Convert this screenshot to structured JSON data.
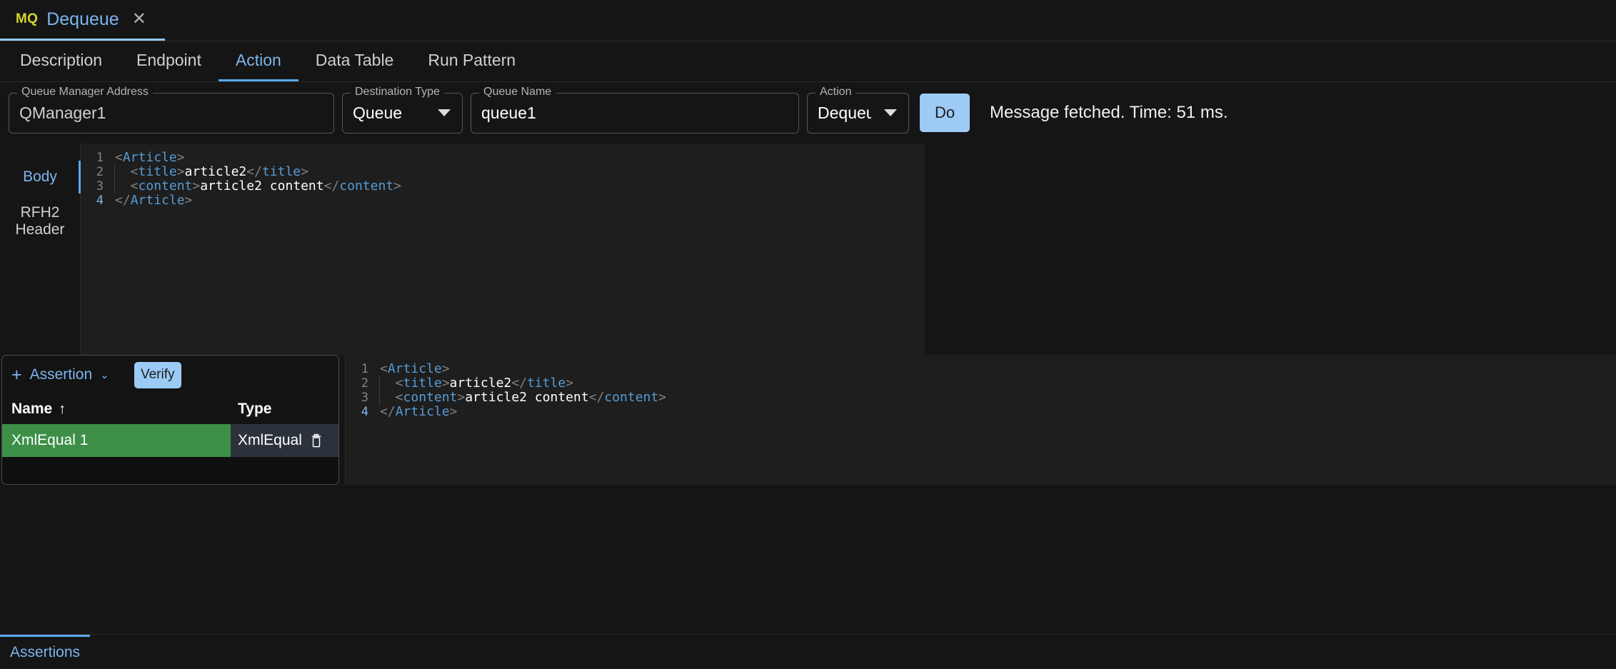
{
  "window_tab": {
    "badge": "MQ",
    "title": "Dequeue",
    "close_icon": "✕"
  },
  "nav_tabs": [
    {
      "label": "Description",
      "active": false
    },
    {
      "label": "Endpoint",
      "active": false
    },
    {
      "label": "Action",
      "active": true
    },
    {
      "label": "Data Table",
      "active": false
    },
    {
      "label": "Run Pattern",
      "active": false
    }
  ],
  "action_bar": {
    "queue_manager": {
      "label": "Queue Manager Address",
      "value": "QManager1"
    },
    "destination_type": {
      "label": "Destination Type",
      "value": "Queue"
    },
    "queue_name": {
      "label": "Queue Name",
      "value": "queue1"
    },
    "action": {
      "label": "Action",
      "value": "Dequeue"
    },
    "do_button": "Do",
    "status": "Message fetched. Time: 51 ms."
  },
  "message_tabs": [
    {
      "label": "Body",
      "active": true
    },
    {
      "label": "RFH2 Header",
      "active": false
    }
  ],
  "body_editor": {
    "lines": [
      {
        "no": "1",
        "segments": [
          {
            "t": "<",
            "c": "tagpunct"
          },
          {
            "t": "Article",
            "c": "tagname"
          },
          {
            "t": ">",
            "c": "tagpunct"
          }
        ]
      },
      {
        "no": "2",
        "segments": [
          {
            "t": "  <",
            "c": "tagpunct"
          },
          {
            "t": "title",
            "c": "tagname"
          },
          {
            "t": ">",
            "c": "tagpunct"
          },
          {
            "t": "article2",
            "c": "text"
          },
          {
            "t": "</",
            "c": "tagpunct"
          },
          {
            "t": "title",
            "c": "tagname"
          },
          {
            "t": ">",
            "c": "tagpunct"
          }
        ]
      },
      {
        "no": "3",
        "segments": [
          {
            "t": "  <",
            "c": "tagpunct"
          },
          {
            "t": "content",
            "c": "tagname"
          },
          {
            "t": ">",
            "c": "tagpunct"
          },
          {
            "t": "article2 content",
            "c": "text"
          },
          {
            "t": "</",
            "c": "tagpunct"
          },
          {
            "t": "content",
            "c": "tagname"
          },
          {
            "t": ">",
            "c": "tagpunct"
          }
        ]
      },
      {
        "no": "4",
        "segments": [
          {
            "t": "</",
            "c": "tagpunct"
          },
          {
            "t": "Article",
            "c": "tagname"
          },
          {
            "t": ">",
            "c": "tagpunct"
          }
        ],
        "active": true
      }
    ]
  },
  "assertions_panel": {
    "add_label": "Assertion",
    "add_icon": "+",
    "chevron_icon": "⌄",
    "verify_button": "Verify",
    "columns": [
      {
        "label": "Name",
        "sort": "↑"
      },
      {
        "label": "Type",
        "sort": ""
      }
    ],
    "rows": [
      {
        "name": "XmlEqual 1",
        "type": "XmlEqual",
        "status_color": "#3d8f47",
        "delete_icon": "trash-icon"
      }
    ]
  },
  "assertion_editor": {
    "lines": [
      {
        "no": "1",
        "segments": [
          {
            "t": "<",
            "c": "tagpunct"
          },
          {
            "t": "Article",
            "c": "tagname"
          },
          {
            "t": ">",
            "c": "tagpunct"
          }
        ]
      },
      {
        "no": "2",
        "segments": [
          {
            "t": "  <",
            "c": "tagpunct"
          },
          {
            "t": "title",
            "c": "tagname"
          },
          {
            "t": ">",
            "c": "tagpunct"
          },
          {
            "t": "article2",
            "c": "text"
          },
          {
            "t": "</",
            "c": "tagpunct"
          },
          {
            "t": "title",
            "c": "tagname"
          },
          {
            "t": ">",
            "c": "tagpunct"
          }
        ]
      },
      {
        "no": "3",
        "segments": [
          {
            "t": "  <",
            "c": "tagpunct"
          },
          {
            "t": "content",
            "c": "tagname"
          },
          {
            "t": ">",
            "c": "tagpunct"
          },
          {
            "t": "article2 content",
            "c": "text"
          },
          {
            "t": "</",
            "c": "tagpunct"
          },
          {
            "t": "content",
            "c": "tagname"
          },
          {
            "t": ">",
            "c": "tagpunct"
          }
        ]
      },
      {
        "no": "4",
        "segments": [
          {
            "t": "</",
            "c": "tagpunct"
          },
          {
            "t": "Article",
            "c": "tagname"
          },
          {
            "t": ">",
            "c": "tagpunct"
          }
        ],
        "active": true
      }
    ]
  },
  "footer": {
    "tab_label": "Assertions"
  },
  "colors": {
    "accent_blue": "#7bb6ef",
    "button_blue": "#9ecbf5",
    "pass_green": "#3d8f47",
    "badge_yellow": "#d6d62e",
    "editor_bg": "#1e1e1e",
    "page_bg": "#151515"
  }
}
